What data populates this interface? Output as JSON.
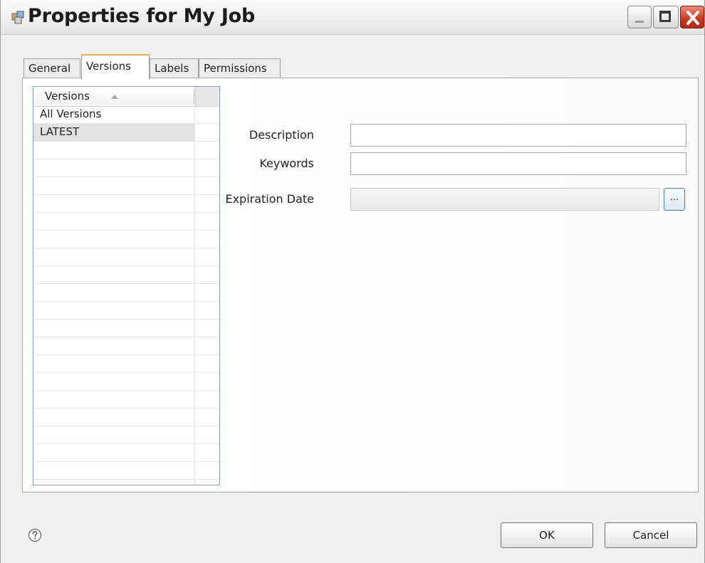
{
  "window": {
    "title": "Properties for My Job"
  },
  "tabs": [
    {
      "label": "General"
    },
    {
      "label": "Versions"
    },
    {
      "label": "Labels"
    },
    {
      "label": "Permissions"
    }
  ],
  "versions_list": {
    "header": "Versions",
    "items": [
      {
        "label": "All Versions"
      },
      {
        "label": "LATEST",
        "selected": true
      }
    ]
  },
  "form": {
    "description_label": "Description",
    "description_value": "",
    "keywords_label": "Keywords",
    "keywords_value": "",
    "expiration_label": "Expiration Date",
    "expiration_value": "",
    "browse_label": "..."
  },
  "buttons": {
    "ok": "OK",
    "cancel": "Cancel"
  },
  "icons": {
    "title": "job-icon",
    "sort": "sort-ascending-icon",
    "help": "help-icon",
    "minimize": "minimize-icon",
    "maximize": "maximize-icon",
    "close": "close-icon"
  }
}
